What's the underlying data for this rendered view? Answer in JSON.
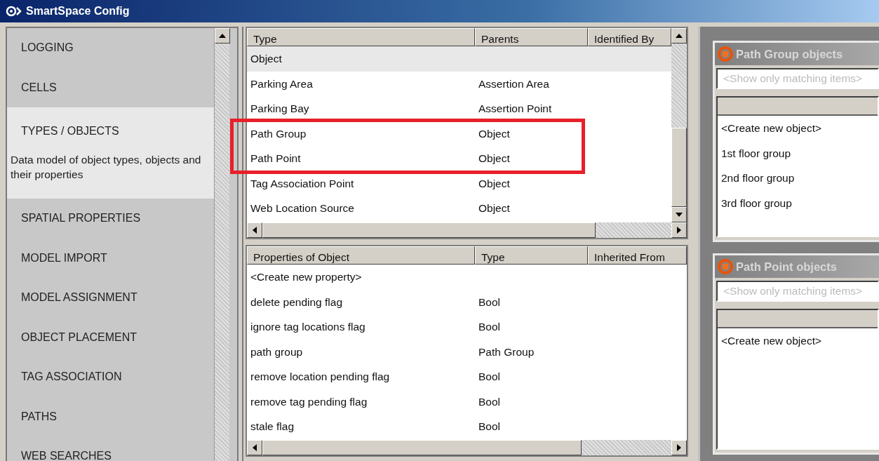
{
  "window": {
    "title": "SmartSpace Config"
  },
  "sidebar": {
    "items": [
      {
        "label": "LOGGING",
        "selected": false
      },
      {
        "label": "CELLS",
        "selected": false
      },
      {
        "label": "TYPES / OBJECTS",
        "selected": true,
        "description": "Data model of object types, objects and their properties"
      },
      {
        "label": "SPATIAL PROPERTIES",
        "selected": false
      },
      {
        "label": "MODEL IMPORT",
        "selected": false
      },
      {
        "label": "MODEL ASSIGNMENT",
        "selected": false
      },
      {
        "label": "OBJECT PLACEMENT",
        "selected": false
      },
      {
        "label": "TAG ASSOCIATION",
        "selected": false
      },
      {
        "label": "PATHS",
        "selected": false
      },
      {
        "label": "WEB SEARCHES",
        "selected": false
      }
    ]
  },
  "types_table": {
    "columns": [
      "Type",
      "Parents",
      "Identified By"
    ],
    "rows": [
      {
        "cells": [
          "Object",
          ""
        ],
        "selected": true,
        "highlighted": false
      },
      {
        "cells": [
          "Parking Area",
          "Assertion Area"
        ],
        "selected": false,
        "highlighted": false
      },
      {
        "cells": [
          "Parking Bay",
          "Assertion Point"
        ],
        "selected": false,
        "highlighted": false
      },
      {
        "cells": [
          "Path Group",
          "Object"
        ],
        "selected": false,
        "highlighted": true
      },
      {
        "cells": [
          "Path Point",
          "Object"
        ],
        "selected": false,
        "highlighted": true
      },
      {
        "cells": [
          "Tag Association Point",
          "Object"
        ],
        "selected": false,
        "highlighted": false
      },
      {
        "cells": [
          "Web Location Source",
          "Object"
        ],
        "selected": false,
        "highlighted": false
      }
    ]
  },
  "properties_table": {
    "columns": [
      "Properties of Object",
      "Type",
      "Inherited From"
    ],
    "rows": [
      {
        "cells": [
          "<Create new property>",
          ""
        ]
      },
      {
        "cells": [
          "delete pending flag",
          "Bool"
        ]
      },
      {
        "cells": [
          "ignore tag locations flag",
          "Bool"
        ]
      },
      {
        "cells": [
          "path group",
          "Path Group"
        ]
      },
      {
        "cells": [
          "remove location pending flag",
          "Bool"
        ]
      },
      {
        "cells": [
          "remove tag pending flag",
          "Bool"
        ]
      },
      {
        "cells": [
          "stale flag",
          "Bool"
        ]
      }
    ]
  },
  "object_panels": [
    {
      "title": "Path Group objects",
      "filter": {
        "placeholder": "<Show only matching items>"
      },
      "items": [
        "<Create new object>",
        "1st floor group",
        "2nd floor group",
        "3rd floor group"
      ]
    },
    {
      "title": "Path Point objects",
      "filter": {
        "placeholder": "<Show only matching items>"
      },
      "items": [
        "<Create new object>"
      ]
    }
  ]
}
